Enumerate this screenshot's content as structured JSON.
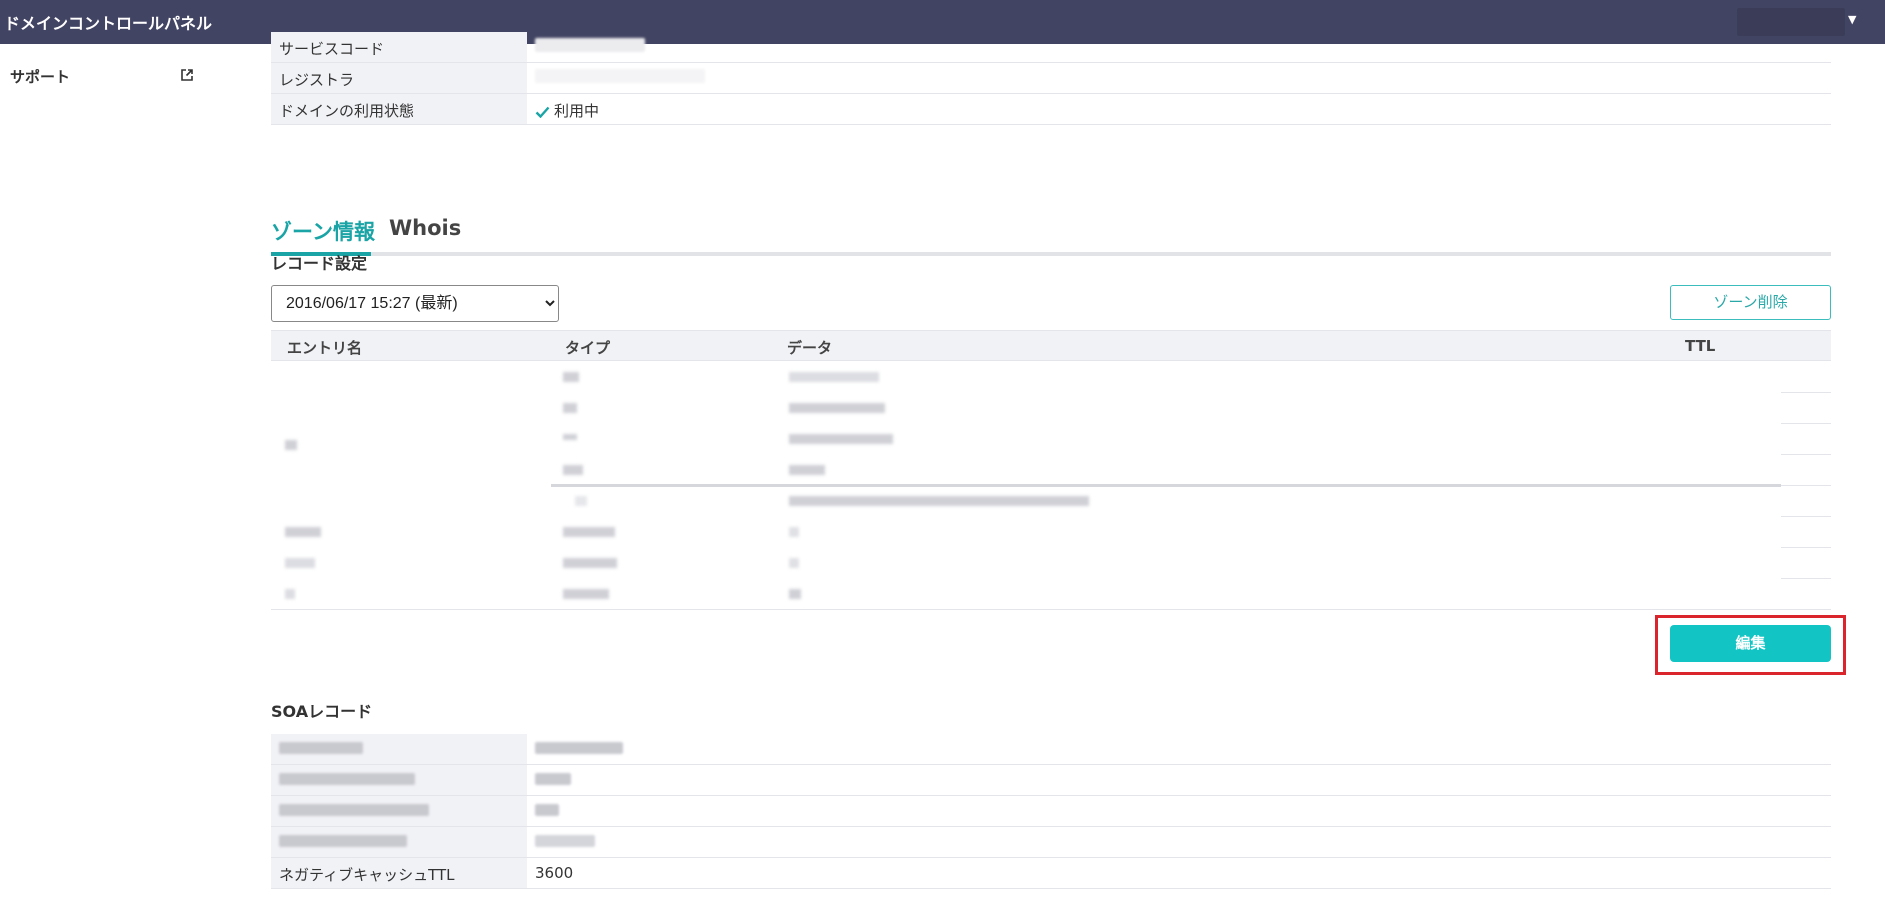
{
  "header": {
    "app_title": "ドメインコントロールパネル",
    "user_menu_icon": "chevron-down-icon"
  },
  "sidebar": {
    "items": [
      {
        "label": "サポート",
        "icon": "external-link-icon"
      }
    ]
  },
  "domain_info": {
    "rows": [
      {
        "key": "サービスコード",
        "value": ""
      },
      {
        "key": "レジストラ",
        "value": ""
      },
      {
        "key": "ドメインの利用状態",
        "value": "利用中",
        "icon": "check-icon"
      }
    ]
  },
  "tabs": [
    {
      "label": "ゾーン情報",
      "active": true
    },
    {
      "label": "Whois",
      "active": false
    }
  ],
  "record_settings": {
    "title": "レコード設定",
    "selected_version": "2016/06/17 15:27 (最新)",
    "zone_delete_label": "ゾーン削除",
    "columns": [
      "エントリ名",
      "タイプ",
      "データ",
      "TTL"
    ],
    "edit_label": "編集"
  },
  "soa": {
    "title": "SOAレコード",
    "rows": [
      {
        "key": "",
        "value": ""
      },
      {
        "key": "",
        "value": ""
      },
      {
        "key": "",
        "value": ""
      },
      {
        "key": "",
        "value": ""
      },
      {
        "key": "ネガティブキャッシュTTL",
        "value": "3600"
      }
    ]
  },
  "colors": {
    "header_bg": "#424463",
    "accent": "#1aa4a6",
    "edit_button": "#13c4c4",
    "highlight": "#d9252b"
  }
}
